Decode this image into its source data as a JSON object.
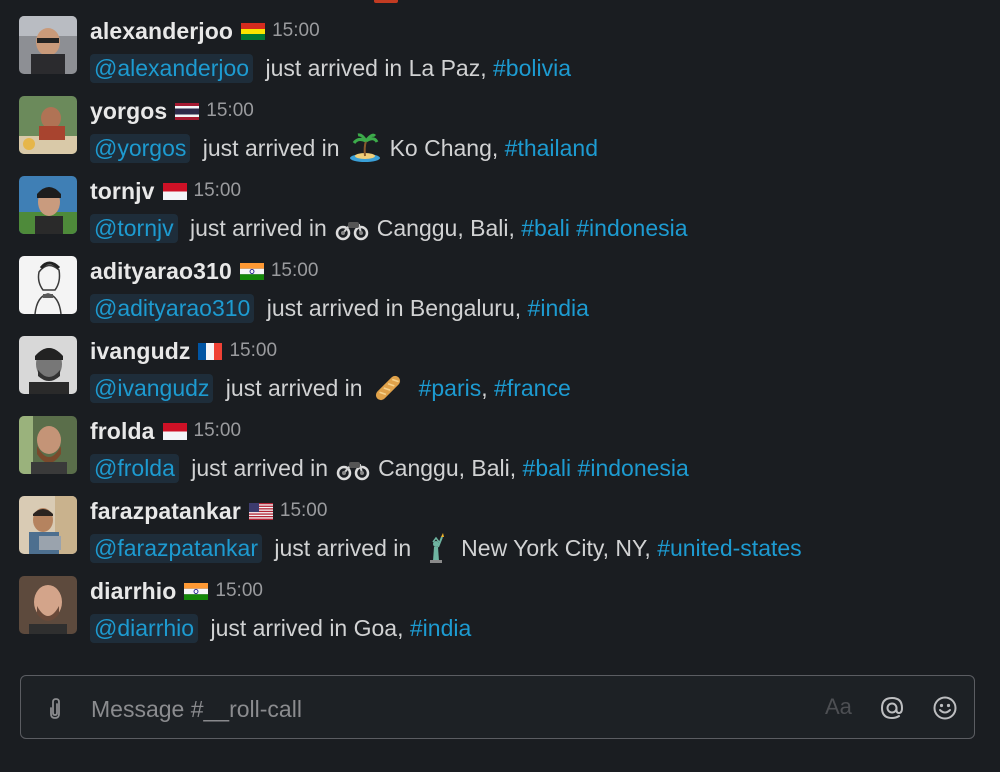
{
  "channel": "__roll-call",
  "composer": {
    "placeholder": "Message #__roll-call",
    "format_label": "Aa"
  },
  "messages": [
    {
      "user": "alexanderjoo",
      "flag": "bolivia-flag",
      "time": "15:00",
      "mention": "@alexanderjoo",
      "text_before": " just arrived in La Paz, ",
      "emoji": null,
      "text_after": "",
      "tags": [
        "#bolivia"
      ]
    },
    {
      "user": "yorgos",
      "flag": "thailand-flag",
      "time": "15:00",
      "mention": "@yorgos",
      "text_before": " just arrived in",
      "emoji": "desert-island-emoji",
      "text_after": "Ko Chang, ",
      "tags": [
        "#thailand"
      ]
    },
    {
      "user": "tornjv",
      "flag": "indonesia-flag",
      "time": "15:00",
      "mention": "@tornjv",
      "text_before": " just arrived in",
      "emoji": "motorcycle-emoji",
      "text_after": "Canggu, Bali, ",
      "tags": [
        "#bali",
        "#indonesia"
      ]
    },
    {
      "user": "adityarao310",
      "flag": "india-flag",
      "time": "15:00",
      "mention": "@adityarao310",
      "text_before": " just arrived in Bengaluru, ",
      "emoji": null,
      "text_after": "",
      "tags": [
        "#india"
      ]
    },
    {
      "user": "ivangudz",
      "flag": "france-flag",
      "time": "15:00",
      "mention": "@ivangudz",
      "text_before": " just arrived in",
      "emoji": "baguette-emoji",
      "text_after": "",
      "tags": [
        "#paris",
        "#france"
      ]
    },
    {
      "user": "frolda",
      "flag": "indonesia-flag",
      "time": "15:00",
      "mention": "@frolda",
      "text_before": " just arrived in",
      "emoji": "motorcycle-emoji",
      "text_after": "Canggu, Bali, ",
      "tags": [
        "#bali",
        "#indonesia"
      ]
    },
    {
      "user": "farazpatankar",
      "flag": "usa-flag",
      "time": "15:00",
      "mention": "@farazpatankar",
      "text_before": " just arrived in",
      "emoji": "statue-of-liberty-emoji",
      "text_after": "New York City, NY, ",
      "tags": [
        "#united-states"
      ]
    },
    {
      "user": "diarrhio",
      "flag": "india-flag",
      "time": "15:00",
      "mention": "@diarrhio",
      "text_before": " just arrived in Goa, ",
      "emoji": null,
      "text_after": "",
      "tags": [
        "#india"
      ]
    }
  ],
  "colors": {
    "background": "#1a1d21",
    "link": "#1d9bd1",
    "text": "#d1d2d3"
  }
}
